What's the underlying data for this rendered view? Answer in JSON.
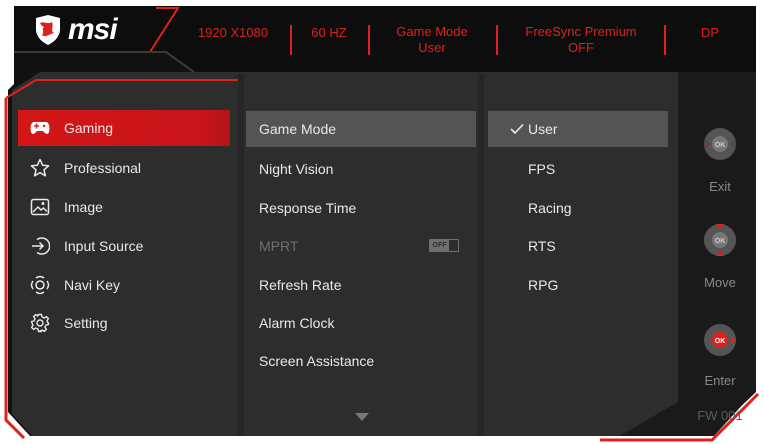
{
  "brand": {
    "logo_text": "msi"
  },
  "status_bar": {
    "resolution": "1920 X1080",
    "refresh": "60 HZ",
    "game_mode_line1": "Game Mode",
    "game_mode_line2": "User",
    "freesync_line1": "FreeSync Premium",
    "freesync_line2": "OFF",
    "input": "DP"
  },
  "categories": [
    {
      "label": "Gaming",
      "icon": "gamepad-icon"
    },
    {
      "label": "Professional",
      "icon": "star-icon"
    },
    {
      "label": "Image",
      "icon": "image-icon"
    },
    {
      "label": "Input Source",
      "icon": "input-source-icon"
    },
    {
      "label": "Navi Key",
      "icon": "navi-key-icon"
    },
    {
      "label": "Setting",
      "icon": "gear-icon"
    }
  ],
  "menu": [
    {
      "label": "Game Mode"
    },
    {
      "label": "Night Vision"
    },
    {
      "label": "Response Time"
    },
    {
      "label": "MPRT",
      "toggle": "OFF"
    },
    {
      "label": "Refresh Rate"
    },
    {
      "label": "Alarm Clock"
    },
    {
      "label": "Screen Assistance"
    }
  ],
  "options": [
    {
      "label": "User",
      "selected": true
    },
    {
      "label": "FPS"
    },
    {
      "label": "Racing"
    },
    {
      "label": "RTS"
    },
    {
      "label": "RPG"
    }
  ],
  "navigation": {
    "exit_label": "Exit",
    "move_label": "Move",
    "enter_label": "Enter",
    "joystick_center": "OK",
    "firmware": "FW 001"
  },
  "colors": {
    "accent": "#e0201b",
    "panel": "#2d2d2d",
    "highlight": "#545454",
    "chrome": "#151515"
  }
}
